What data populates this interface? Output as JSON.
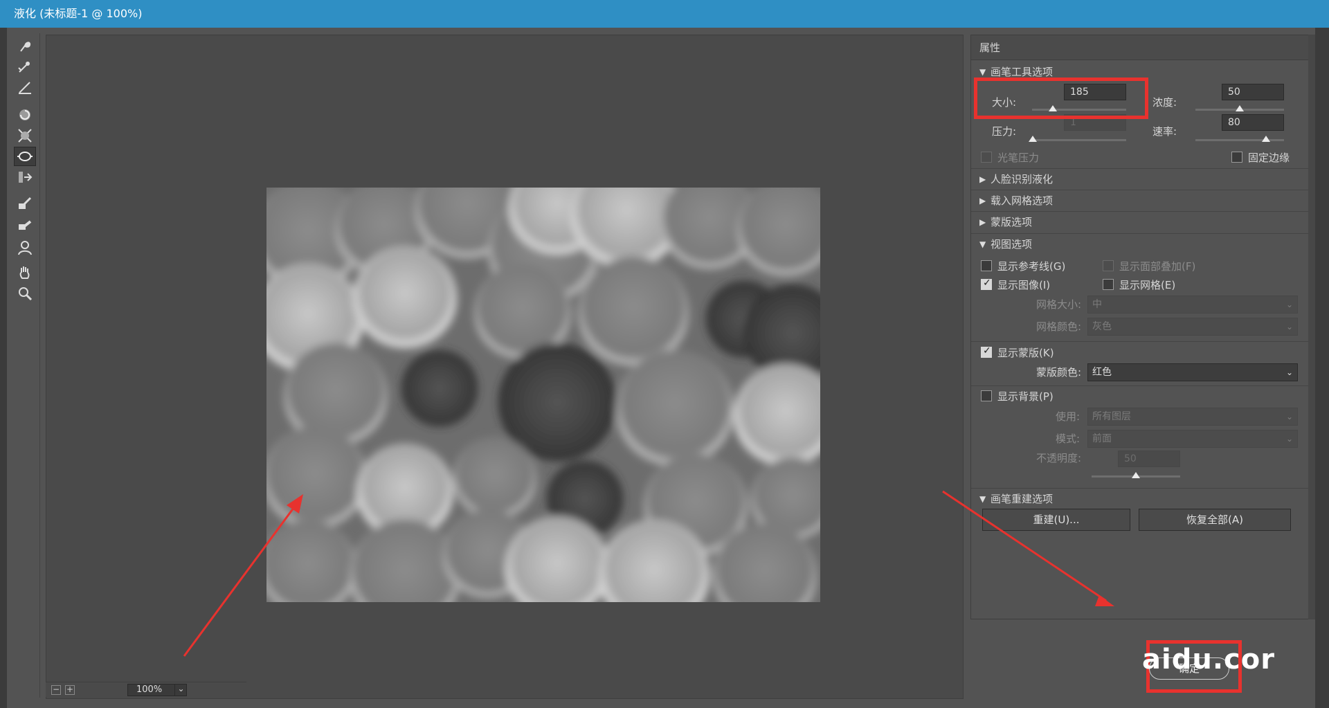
{
  "window": {
    "title": "液化 (未标题-1 @ 100%)"
  },
  "toolbar": {
    "tools": [
      {
        "name": "forward-warp-icon"
      },
      {
        "name": "reconstruct-icon"
      },
      {
        "name": "smooth-icon"
      },
      {
        "name": "twirl-icon"
      },
      {
        "name": "pucker-icon"
      },
      {
        "name": "bloat-icon",
        "active": true
      },
      {
        "name": "push-left-icon"
      },
      {
        "name": "freeze-mask-icon"
      },
      {
        "name": "thaw-mask-icon"
      },
      {
        "name": "face-tool-icon"
      },
      {
        "name": "hand-icon"
      },
      {
        "name": "zoom-icon"
      }
    ]
  },
  "zoom": {
    "value": "100%",
    "minus": "−",
    "plus": "+",
    "chevron": "⌄"
  },
  "panel": {
    "title": "属性",
    "brush_tool": {
      "header": "画笔工具选项",
      "size_label": "大小:",
      "size_value": "185",
      "size_pos": 0.22,
      "density_label": "浓度:",
      "density_value": "50",
      "density_pos": 0.5,
      "pressure_label": "压力:",
      "pressure_value": "1",
      "pressure_pos": 0.01,
      "rate_label": "速率:",
      "rate_value": "80",
      "rate_pos": 0.8,
      "stylus_label": "光笔压力",
      "pin_edges_label": "固定边缘"
    },
    "face_aware": {
      "header": "人脸识别液化"
    },
    "load_mesh": {
      "header": "载入网格选项"
    },
    "mask": {
      "header": "蒙版选项"
    },
    "view": {
      "header": "视图选项",
      "show_guides": "显示参考线(G)",
      "show_face_overlay": "显示面部叠加(F)",
      "show_image": "显示图像(I)",
      "show_mesh": "显示网格(E)",
      "mesh_size_label": "网格大小:",
      "mesh_size_value": "中",
      "mesh_color_label": "网格颜色:",
      "mesh_color_value": "灰色",
      "show_mask": "显示蒙版(K)",
      "mask_color_label": "蒙版颜色:",
      "mask_color_value": "红色",
      "show_backdrop": "显示背景(P)",
      "use_label": "使用:",
      "use_value": "所有图层",
      "mode_label": "模式:",
      "mode_value": "前面",
      "opacity_label": "不透明度:",
      "opacity_value": "50",
      "opacity_pos": 0.5
    },
    "brush_reconstruct": {
      "header": "画笔重建选项",
      "reconstruct_button": "重建(U)...",
      "restore_all_button": "恢复全部(A)"
    }
  },
  "footer": {
    "ok_button": "确定",
    "watermark": "aidu.cor"
  },
  "colors": {
    "titlebar": "#2f8fc4",
    "highlight": "#e8322e",
    "panel": "#535353"
  }
}
